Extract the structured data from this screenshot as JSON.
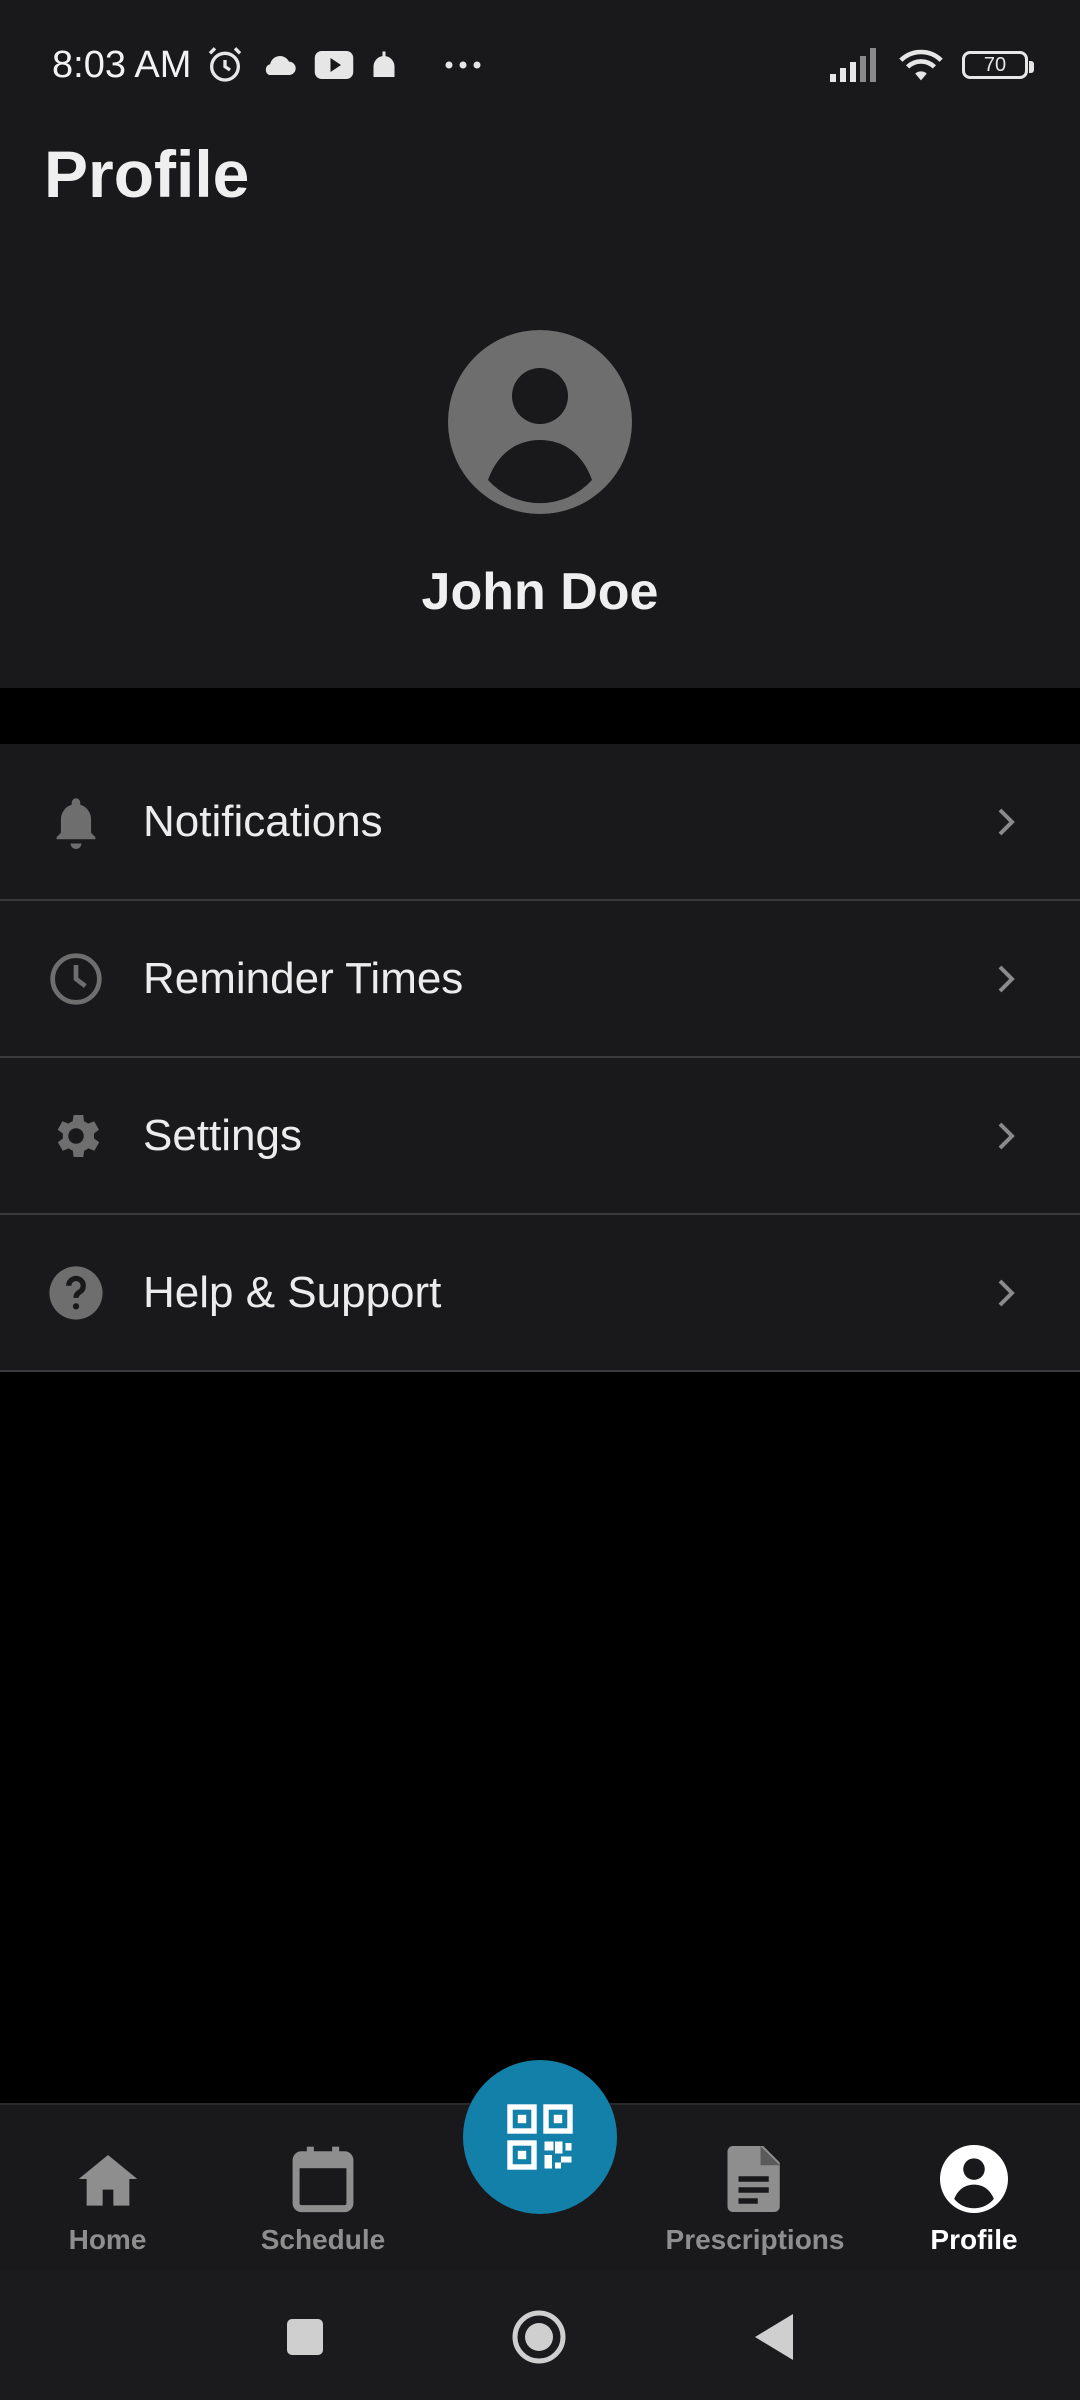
{
  "status_bar": {
    "time": "8:03 AM",
    "battery": "70",
    "icons": [
      "alarm-icon",
      "cloud-icon",
      "youtube-icon",
      "mosque-icon",
      "more-dots-icon",
      "signal-icon",
      "wifi-icon",
      "battery-icon"
    ]
  },
  "header": {
    "title": "Profile",
    "user_name": "John Doe"
  },
  "menu": {
    "items": [
      {
        "label": "Notifications",
        "icon": "bell-icon"
      },
      {
        "label": "Reminder Times",
        "icon": "clock-icon"
      },
      {
        "label": "Settings",
        "icon": "gear-icon"
      },
      {
        "label": "Help & Support",
        "icon": "help-icon"
      }
    ]
  },
  "bottom_nav": {
    "items": [
      {
        "label": "Home",
        "icon": "home-icon",
        "active": false
      },
      {
        "label": "Schedule",
        "icon": "calendar-icon",
        "active": false
      },
      {
        "label": "Prescriptions",
        "icon": "document-icon",
        "active": false
      },
      {
        "label": "Profile",
        "icon": "profile-icon",
        "active": true
      }
    ],
    "fab_icon": "qr-code-icon"
  },
  "colors": {
    "background": "#000000",
    "surface": "#19191b",
    "accent": "#1280a8",
    "icon_muted": "#6e6e6e",
    "text_inactive": "#8e8e8e"
  }
}
